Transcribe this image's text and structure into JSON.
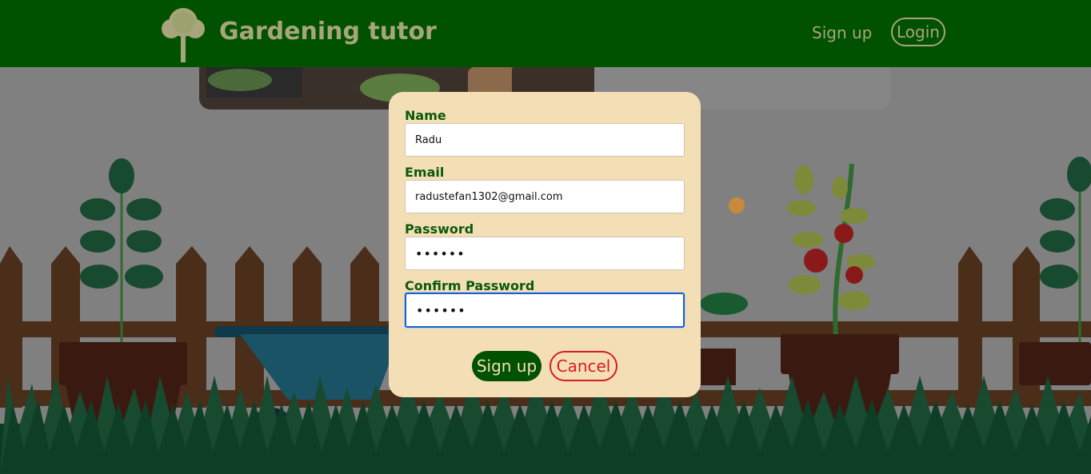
{
  "header": {
    "brand": "Gardening tutor",
    "nav": {
      "signup_label": "Sign up",
      "login_label": "Login"
    }
  },
  "form": {
    "name_label": "Name",
    "name_value": "Radu",
    "email_label": "Email",
    "email_value": "radustefan1302@gmail.com",
    "password_label": "Password",
    "password_value": "••••••",
    "confirm_label": "Confirm Password",
    "confirm_value": "••••••",
    "submit_label": "Sign up",
    "cancel_label": "Cancel"
  },
  "colors": {
    "header_bg": "#005200",
    "brand_text": "#a8a57c",
    "modal_bg": "#f4deb6",
    "label_text": "#0a5a0a",
    "cancel_red": "#d81d1d",
    "focus_blue": "#1a5fc9"
  }
}
